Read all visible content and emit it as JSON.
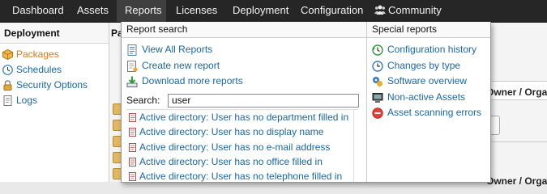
{
  "nav": {
    "items": [
      "Dashboard",
      "Assets",
      "Reports",
      "Licenses",
      "Deployment",
      "Configuration",
      "Community"
    ],
    "active": "Reports"
  },
  "sidebar": {
    "header": "Deployment",
    "items": [
      "Packages",
      "Schedules",
      "Security Options",
      "Logs"
    ]
  },
  "background": {
    "page_title_fragment": "Pa",
    "owner_header": "Owner / Organizat",
    "owner_header_2": "Owner / Organ",
    "button_fragment": "rt"
  },
  "dropdown": {
    "left_header": "Report search",
    "actions": [
      "View All Reports",
      "Create new report",
      "Download more reports"
    ],
    "search_label": "Search:",
    "search_value": "user",
    "results": [
      "Active directory: User has no department filled in",
      "Active directory: User has no display name",
      "Active directory: User has no e-mail address",
      "Active directory: User has no office filled in",
      "Active directory: User has no telephone filled in"
    ],
    "right_header": "Special reports",
    "special": [
      "Configuration history",
      "Changes by type",
      "Software overview",
      "Non-active Assets",
      "Asset scanning errors"
    ]
  }
}
